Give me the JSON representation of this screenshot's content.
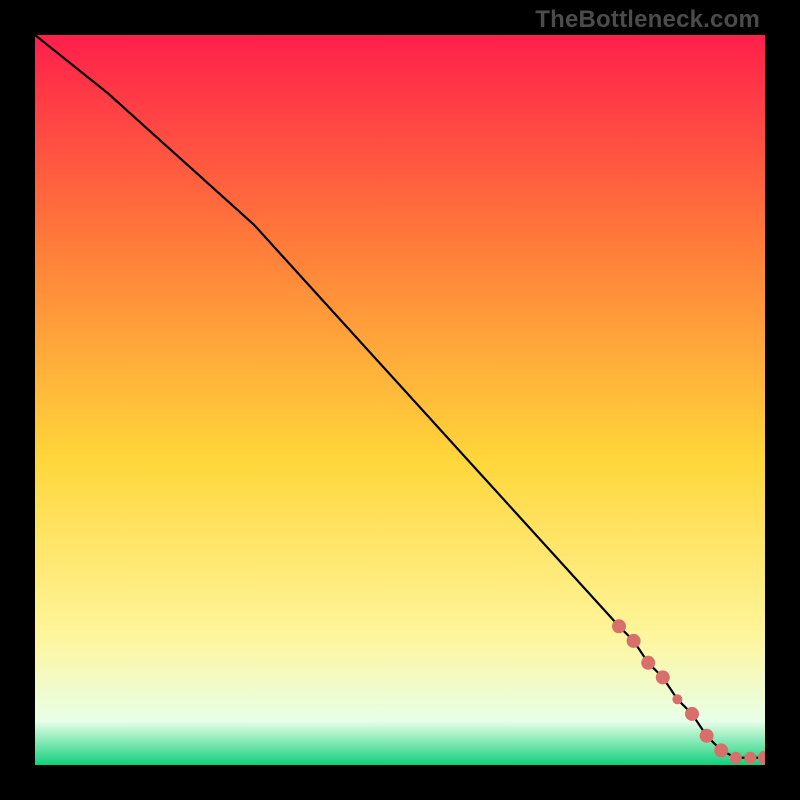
{
  "watermark": "TheBottleneck.com",
  "colors": {
    "frame_bg": "#000000",
    "line": "#000000",
    "marker": "#d96f6b",
    "gradient_top": "#ff1f4b",
    "gradient_mid_upper": "#ff7a3a",
    "gradient_mid": "#ffd63a",
    "gradient_mid_lower": "#fff59a",
    "gradient_near_bottom": "#e8ffe8",
    "gradient_bottom": "#12d07a"
  },
  "chart_data": {
    "type": "line",
    "xlim": [
      0,
      100
    ],
    "ylim": [
      0,
      100
    ],
    "title": "",
    "xlabel": "",
    "ylabel": "",
    "series": [
      {
        "name": "curve",
        "x": [
          0,
          10,
          20,
          30,
          40,
          50,
          60,
          70,
          80,
          82,
          84,
          86,
          88,
          90,
          92,
          94,
          96,
          98,
          100
        ],
        "values": [
          100,
          92,
          83,
          74,
          63,
          52,
          41,
          30,
          19,
          17,
          14,
          12,
          9,
          7,
          4,
          2,
          1,
          1,
          1
        ]
      }
    ],
    "markers": {
      "name": "highlight-points",
      "x": [
        80,
        82,
        84,
        86,
        88,
        90,
        92,
        94,
        96,
        98,
        100
      ],
      "values": [
        19,
        17,
        14,
        12,
        9,
        7,
        4,
        2,
        1,
        1,
        1
      ],
      "radius": [
        7,
        7,
        7,
        7,
        5,
        7,
        7,
        7,
        6,
        6,
        7
      ]
    }
  }
}
